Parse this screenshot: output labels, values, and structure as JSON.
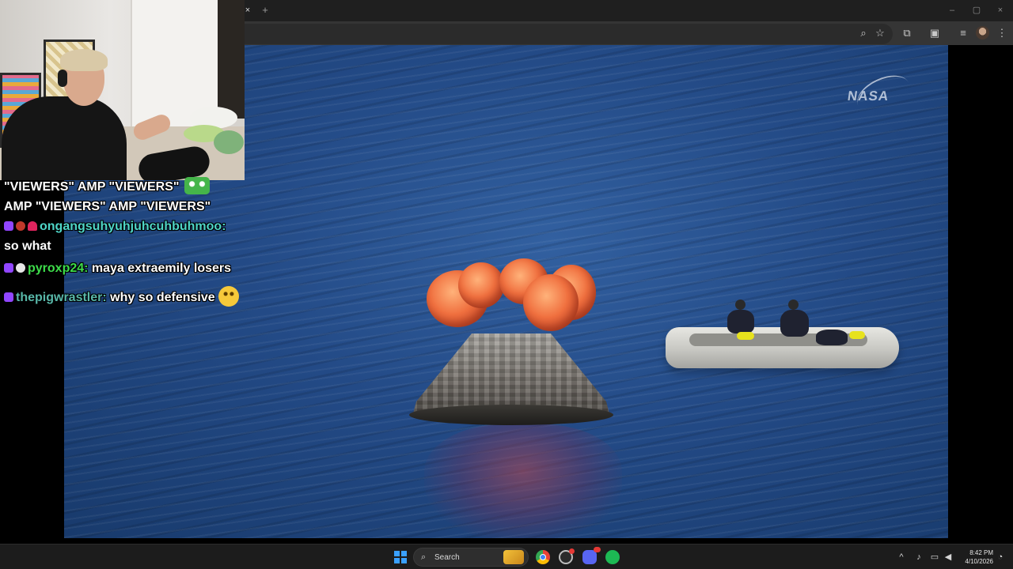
{
  "browser": {
    "tab_close_glyph": "×",
    "new_tab_glyph": "+",
    "window_controls": [
      "–",
      "▢",
      "×"
    ],
    "toolbar_icons": [
      "zoom-icon",
      "bookmark-star-icon",
      "extensions-icon",
      "cast-icon",
      "reading-list-icon",
      "profile-avatar",
      "menu-icon"
    ]
  },
  "video": {
    "watermark": "NASA"
  },
  "chat": {
    "lines": [
      {
        "text": "\"VIEWERS\"  AMP \"VIEWERS\" "
      },
      {
        "text": "AMP \"VIEWERS\"  AMP \"VIEWERS\""
      },
      {
        "user": "ongangsuhyuhjuhcuhbuhmoo:",
        "user_color": "#4fd6c8"
      },
      {
        "text": "so what"
      },
      {
        "user": "pyroxp24:",
        "user_color": "#3ddc4a",
        "text": " maya extraemily losers"
      },
      {
        "user": "thepigwrastler:",
        "user_color": "#58b7a8",
        "text": " why so defensive"
      }
    ]
  },
  "taskbar": {
    "search_placeholder": "Search",
    "apps": [
      "chrome-icon",
      "system-monitor-icon",
      "discord-icon",
      "spotify-icon"
    ],
    "tray_chevron": "^",
    "time": "8:42 PM",
    "date": "4/10/2026",
    "colors": {
      "chrome": "#4285f4",
      "discord": "#5865f2",
      "spotify": "#1db954"
    }
  }
}
